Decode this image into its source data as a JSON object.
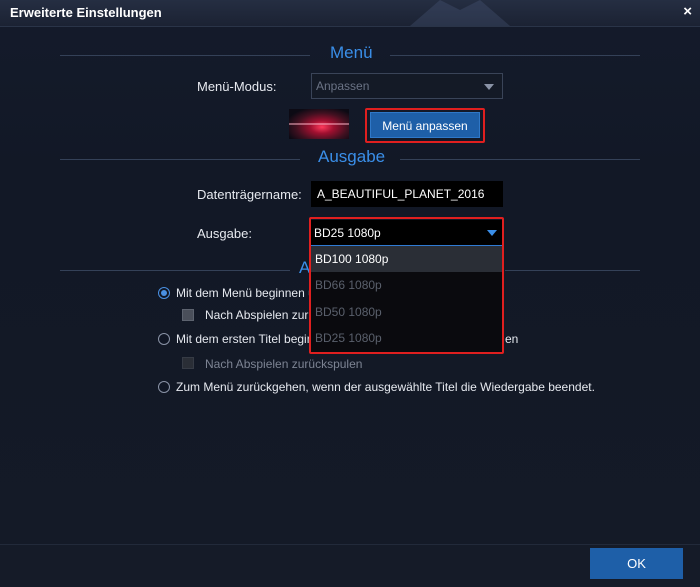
{
  "window": {
    "title": "Erweiterte Einstellungen",
    "close_glyph": "×"
  },
  "menu_section": {
    "heading": "Menü",
    "mode_label": "Menü-Modus:",
    "mode_value": "Anpassen",
    "customize_button": "Menü anpassen"
  },
  "output_section": {
    "heading": "Ausgabe",
    "disc_name_label": "Datenträgername:",
    "disc_name_value": "A_BEAUTIFUL_PLANET_2016",
    "output_label": "Ausgabe:",
    "output_value": "BD25 1080p",
    "options": [
      "BD100 1080p",
      "BD66 1080p",
      "BD50 1080p",
      "BD25 1080p"
    ]
  },
  "playback_section": {
    "heading_visible": "A",
    "options": [
      {
        "text_visible": "Mit dem Menü beginnen u",
        "checked": true
      },
      {
        "text_visible": "Mit dem ersten Titel beginn",
        "trailing": "en",
        "checked": false
      },
      {
        "text_visible": "Zum Menü zurückgehen, wenn der ausgewählte Titel die Wiedergabe beendet.",
        "checked": false
      }
    ],
    "sub_options": [
      {
        "text_visible": "Nach Abspielen zurü",
        "enabled": true
      },
      {
        "text_visible": "Nach Abspielen zurückspulen",
        "enabled": false
      }
    ]
  },
  "footer": {
    "ok_label": "OK"
  },
  "colors": {
    "accent": "#3a8ee8",
    "button": "#1e5fa8",
    "highlight": "#e01f1f"
  }
}
